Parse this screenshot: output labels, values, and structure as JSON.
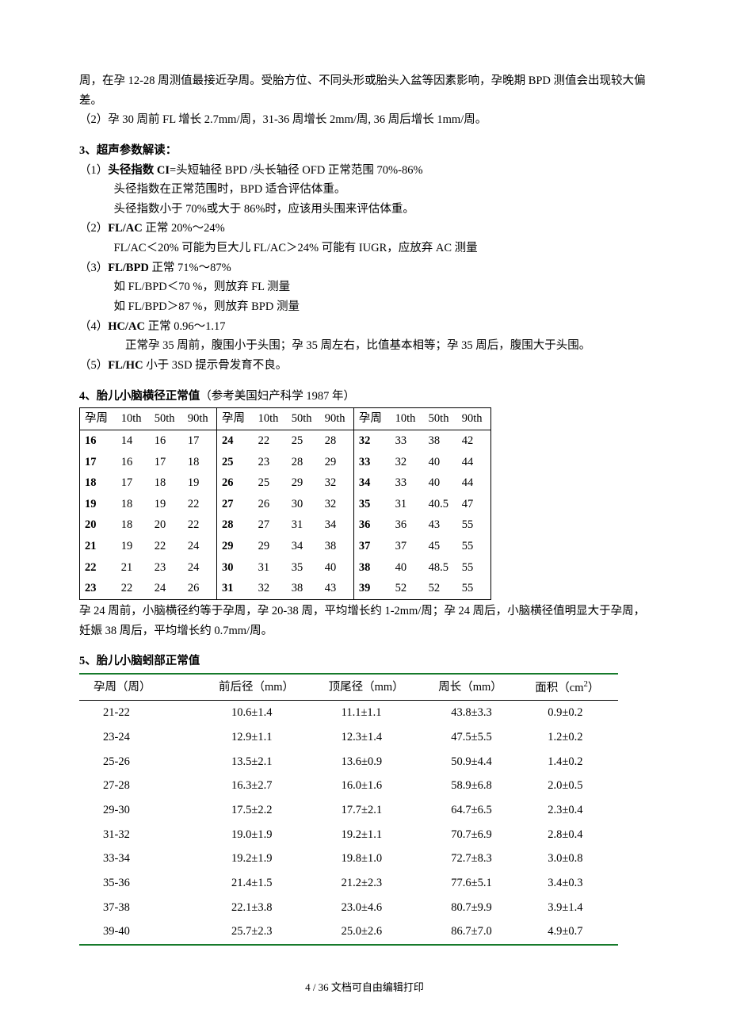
{
  "intro": {
    "p1": "周，在孕 12-28 周测值最接近孕周。受胎方位、不同头形或胎头入盆等因素影响，孕晚期 BPD 测值会出现较大偏差。",
    "p2": "（2）孕 30 周前 FL 增长 2.7mm/周，31-36 周增长 2mm/周, 36 周后增长 1mm/周。"
  },
  "sec3": {
    "title": "3、超声参数解读：",
    "l1a": "（1）",
    "l1b": "头径指数 CI",
    "l1c": "=头短轴径 BPD /头长轴径 OFD   正常范围 70%-86%",
    "l2": "头径指数在正常范围时，BPD 适合评估体重。",
    "l3": "头径指数小于 70%或大于 86%时，应该用头围来评估体重。",
    "l4a": "（2）",
    "l4b": "FL/AC",
    "l4c": "   正常  20%～24%",
    "l5": "FL/AC＜20%  可能为巨大儿          FL/AC＞24%  可能有 IUGR，应放弃 AC 测量",
    "l6a": "（3）",
    "l6b": "FL/BPD",
    "l6c": "  正常  71%～87%",
    "l7": "如 FL/BPD＜70 %，则放弃 FL 测量",
    "l8": "如 FL/BPD＞87 %，则放弃 BPD 测量",
    "l9a": "（4）",
    "l9b": "HC/AC",
    "l9c": "   正常  0.96～1.17",
    "l10": "正常孕 35 周前，腹围小于头围；孕 35 周左右，比值基本相等；孕 35 周后，腹围大于头围。",
    "l11a": "（5）",
    "l11b": "FL/HC",
    "l11c": "    小于 3SD  提示骨发育不良。"
  },
  "sec4": {
    "title_bold": "4、胎儿小脑横径正常值",
    "title_rest": "（参考美国妇产科学 1987 年）",
    "headers": [
      "孕周",
      "10th",
      "50th",
      "90th",
      "孕周",
      "10th",
      "50th",
      "90th",
      "孕周",
      "10th",
      "50th",
      "90th"
    ],
    "rows": [
      [
        "16",
        "14",
        "16",
        "17",
        "24",
        "22",
        "25",
        "28",
        "32",
        "33",
        "38",
        "42"
      ],
      [
        "17",
        "16",
        "17",
        "18",
        "25",
        "23",
        "28",
        "29",
        "33",
        "32",
        "40",
        "44"
      ],
      [
        "18",
        "17",
        "18",
        "19",
        "26",
        "25",
        "29",
        "32",
        "34",
        "33",
        "40",
        "44"
      ],
      [
        "19",
        "18",
        "19",
        "22",
        "27",
        "26",
        "30",
        "32",
        "35",
        "31",
        "40.5",
        "47"
      ],
      [
        "20",
        "18",
        "20",
        "22",
        "28",
        "27",
        "31",
        "34",
        "36",
        "36",
        "43",
        "55"
      ],
      [
        "21",
        "19",
        "22",
        "24",
        "29",
        "29",
        "34",
        "38",
        "37",
        "37",
        "45",
        "55"
      ],
      [
        "22",
        "21",
        "23",
        "24",
        "30",
        "31",
        "35",
        "40",
        "38",
        "40",
        "48.5",
        "55"
      ],
      [
        "23",
        "22",
        "24",
        "26",
        "31",
        "32",
        "38",
        "43",
        "39",
        "52",
        "52",
        "55"
      ]
    ],
    "note": "孕 24 周前，小脑横径约等于孕周，孕 20-38 周，平均增长约 1-2mm/周；孕 24 周后，小脑横径值明显大于孕周，妊娠 38 周后，平均增长约 0.7mm/周。"
  },
  "sec5": {
    "title": "5、胎儿小脑蚓部正常值",
    "headers": [
      "孕周（周）",
      "前后径（mm）",
      "顶尾径（mm）",
      "周长（mm）",
      "面积（cm"
    ],
    "area_sup": "2",
    "area_close": "）",
    "rows": [
      [
        "21-22",
        "10.6±1.4",
        "11.1±1.1",
        "43.8±3.3",
        "0.9±0.2"
      ],
      [
        "23-24",
        "12.9±1.1",
        "12.3±1.4",
        "47.5±5.5",
        "1.2±0.2"
      ],
      [
        "25-26",
        "13.5±2.1",
        "13.6±0.9",
        "50.9±4.4",
        "1.4±0.2"
      ],
      [
        "27-28",
        "16.3±2.7",
        "16.0±1.6",
        "58.9±6.8",
        "2.0±0.5"
      ],
      [
        "29-30",
        "17.5±2.2",
        "17.7±2.1",
        "64.7±6.5",
        "2.3±0.4"
      ],
      [
        "31-32",
        "19.0±1.9",
        "19.2±1.1",
        "70.7±6.9",
        "2.8±0.4"
      ],
      [
        "33-34",
        "19.2±1.9",
        "19.8±1.0",
        "72.7±8.3",
        "3.0±0.8"
      ],
      [
        "35-36",
        "21.4±1.5",
        "21.2±2.3",
        "77.6±5.1",
        "3.4±0.3"
      ],
      [
        "37-38",
        "22.1±3.8",
        "23.0±4.6",
        "80.7±9.9",
        "3.9±1.4"
      ],
      [
        "39-40",
        "25.7±2.3",
        "25.0±2.6",
        "86.7±7.0",
        "4.9±0.7"
      ]
    ]
  },
  "footer": "4 / 36 文档可自由编辑打印"
}
